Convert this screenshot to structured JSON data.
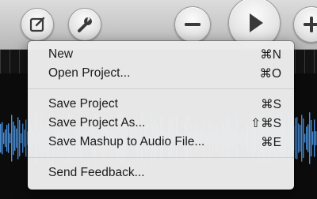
{
  "toolbar": {
    "buttons": [
      {
        "icon": "compose-icon"
      },
      {
        "icon": "wrench-icon"
      },
      {
        "icon": "minus-icon"
      },
      {
        "icon": "play-icon"
      },
      {
        "icon": "plus-icon"
      }
    ]
  },
  "menu": {
    "items": [
      {
        "label": "New",
        "shortcut": "⌘N"
      },
      {
        "label": "Open Project...",
        "shortcut": "⌘O"
      },
      {
        "label": "Save Project",
        "shortcut": "⌘S"
      },
      {
        "label": "Save Project As...",
        "shortcut": "⇧⌘S"
      },
      {
        "label": "Save Mashup to Audio File...",
        "shortcut": "⌘E"
      },
      {
        "label": "Send Feedback...",
        "shortcut": ""
      }
    ]
  },
  "colors": {
    "waveform": "#4a8fd8",
    "menu_background": "#ececec"
  }
}
